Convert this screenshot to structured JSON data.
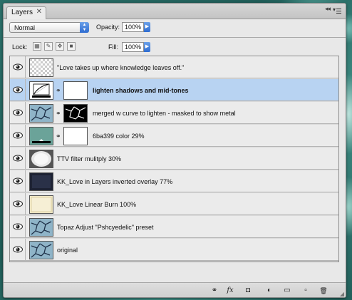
{
  "panel": {
    "tab_label": "Layers",
    "tab_close": "✕",
    "collapse": "◂◂",
    "close": "✕"
  },
  "blend": {
    "mode": "Normal",
    "arrow": "▲▼"
  },
  "opacity": {
    "label": "Opacity:",
    "value": "100%"
  },
  "lock": {
    "label": "Lock:"
  },
  "fill": {
    "label": "Fill:",
    "value": "100%"
  },
  "layers": [
    {
      "name": "\"Love takes up  where knowledge  leaves off.\"",
      "thumb": "transparent",
      "has_mask": false,
      "selected": false
    },
    {
      "name": "lighten shadows and mid-tones",
      "thumb": "curves",
      "has_mask": true,
      "mask": "white",
      "selected": true
    },
    {
      "name": "merged w curve to lighten - masked to show metal",
      "thumb": "crackle",
      "has_mask": true,
      "mask": "black",
      "selected": false
    },
    {
      "name": "6ba399 color 29%",
      "thumb": "solid",
      "thumb_color": "#6ba399",
      "has_mask": true,
      "mask": "white",
      "selected": false
    },
    {
      "name": "TTV filter mulitply 30%",
      "thumb": "ttv",
      "has_mask": false,
      "selected": false
    },
    {
      "name": "KK_Love in Layers inverted overlay 77%",
      "thumb": "dark",
      "has_mask": false,
      "selected": false
    },
    {
      "name": "KK_Love Linear Burn 100%",
      "thumb": "cream",
      "has_mask": false,
      "selected": false
    },
    {
      "name": "Topaz Adjust \"Pshcyedelic\" preset",
      "thumb": "crackle",
      "has_mask": false,
      "selected": false
    },
    {
      "name": "original",
      "thumb": "crackle",
      "has_mask": false,
      "selected": false
    }
  ],
  "footer": {
    "link": "⚭",
    "fx": "fx",
    "mask": "◘",
    "adjust": "◐",
    "group": "▭",
    "new": "▫",
    "trash": "🗑"
  },
  "colors": {
    "selection": "#b8d3f2",
    "stepper": "#2e6cd1",
    "layer_color": "#6ba399"
  }
}
